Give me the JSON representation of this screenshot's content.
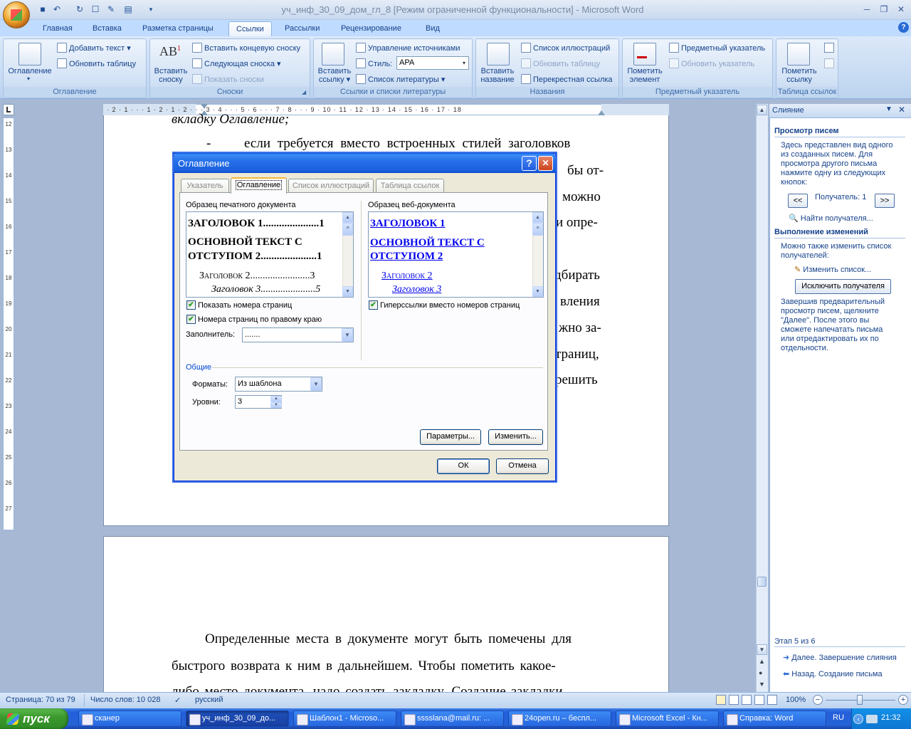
{
  "window": {
    "title": "уч_инф_30_09_дом_гл_8 [Режим ограниченной функциональности] - Microsoft Word"
  },
  "ribbon_tabs": [
    "Главная",
    "Вставка",
    "Разметка страницы",
    "Ссылки",
    "Рассылки",
    "Рецензирование",
    "Вид"
  ],
  "active_tab": "Ссылки",
  "groups": {
    "toc": {
      "label": "Оглавление",
      "big": "Оглавление",
      "add_text": "Добавить текст",
      "update_table": "Обновить таблицу"
    },
    "footnotes": {
      "label": "Сноски",
      "big1": "Вставить",
      "big2": "сноску",
      "insert_endnote": "Вставить концевую сноску",
      "next_footnote": "Следующая сноска",
      "show_notes": "Показать сноски"
    },
    "citations": {
      "label": "Ссылки и списки литературы",
      "big1": "Вставить",
      "big2": "ссылку",
      "manage_sources": "Управление источниками",
      "style_label": "Стиль:",
      "style_value": "APA",
      "bibliography": "Список литературы"
    },
    "captions": {
      "label": "Названия",
      "big1": "Вставить",
      "big2": "название",
      "table_of_figures": "Список иллюстраций",
      "update_table": "Обновить таблицу",
      "cross_reference": "Перекрестная ссылка"
    },
    "index": {
      "label": "Предметный указатель",
      "big1": "Пометить",
      "big2": "элемент",
      "insert_index": "Предметный указатель",
      "update_index": "Обновить указатель"
    },
    "toa": {
      "label": "Таблица ссылок",
      "big1": "Пометить",
      "big2": "ссылку"
    }
  },
  "ruler": {
    "horizontal": "· 2 · 1 · · · 1 · 2 · 1 · 2 · · · 3 · 4 · · · 5 · 6 · · · 7 · 8 · · · 9 · 10 · 11 · 12 · 13 · 14 · 15 · 16 · 17 · 18",
    "vertical": [
      "12",
      "13",
      "14",
      "15",
      "16",
      "17",
      "18",
      "19",
      "20",
      "21",
      "22",
      "23",
      "24",
      "25",
      "26",
      "27"
    ]
  },
  "document": {
    "page1_lines": [
      "вкладку Оглавление;",
      "-",
      "если требуется вместо встроенных стилей заголовков",
      "бы от-",
      "можно",
      "и опре-",
      "дбирать",
      "вления",
      "жно за-",
      "траниц,",
      "решить"
    ],
    "page2_lines": [
      "Определенные места в документе могут быть помечены для",
      "быстрого возврата к ним в дальнейшем. Чтобы пометить какое-",
      "либо место документа, надо создать закладку. Создание закладки"
    ]
  },
  "dialog": {
    "title": "Оглавление",
    "help": "?",
    "close": "✕",
    "tabs": [
      "Указатель",
      "Оглавление",
      "Список иллюстраций",
      "Таблица ссылок"
    ],
    "active_tab": "Оглавление",
    "print_preview_label": "Образец печатного документа",
    "web_preview_label": "Образец веб-документа",
    "print_preview": [
      "ЗАГОЛОВОК 1.....................1",
      "ОСНОВНОЙ ТЕКСТ С",
      "ОТСТУПОМ 2.....................1",
      "Заголовок 2........................3",
      "Заголовок 3......................5"
    ],
    "web_preview": [
      "ЗАГОЛОВОК 1",
      "ОСНОВНОЙ ТЕКСТ С",
      "ОТСТУПОМ 2",
      "Заголовок 2",
      "Заголовок 3"
    ],
    "show_page_numbers": "Показать номера страниц",
    "right_align": "Номера страниц по правому краю",
    "hyperlinks": "Гиперссылки вместо номеров страниц",
    "leader_label": "Заполнитель:",
    "leader_value": ".......",
    "general_label": "Общие",
    "formats_label": "Форматы:",
    "formats_value": "Из шаблона",
    "levels_label": "Уровни:",
    "levels_value": "3",
    "options_btn": "Параметры...",
    "modify_btn": "Изменить...",
    "ok": "ОК",
    "cancel": "Отмена"
  },
  "pane": {
    "title": "Слияние",
    "preview_heading": "Просмотр писем",
    "preview_text": [
      "Здесь представлен вид одного",
      "из созданных писем. Для",
      "просмотра другого письма",
      "нажмите одну из следующих",
      "кнопок:"
    ],
    "prev": "<<",
    "recipient": "Получатель: 1",
    "next": ">>",
    "find_recipient": "Найти получателя...",
    "changes_heading": "Выполнение изменений",
    "changes_text": [
      "Можно также изменить список",
      "получателей:"
    ],
    "edit_list": "Изменить список...",
    "exclude": "Исключить получателя",
    "finish_text": [
      "Завершив предварительный",
      "просмотр писем, щелкните",
      "\"Далее\". После этого вы",
      "сможете напечатать письма",
      "или отредактировать их по",
      "отдельности."
    ],
    "step": "Этап 5 из 6",
    "next_step": "Далее. Завершение слияния",
    "prev_step": "Назад. Создание письма"
  },
  "status": {
    "page": "Страница: 70 из 79",
    "words": "Число слов: 10 028",
    "language": "русский",
    "zoom": "100%"
  },
  "taskbar": {
    "start": "пуск",
    "tasks": [
      "сканер",
      "уч_инф_30_09_до...",
      "Шаблон1 - Microso...",
      "sssslana@mail.ru: ...",
      "24open.ru – беспл...",
      "Microsoft Excel - Кн...",
      "Справка: Word"
    ],
    "lang": "RU",
    "clock": "21:32"
  }
}
